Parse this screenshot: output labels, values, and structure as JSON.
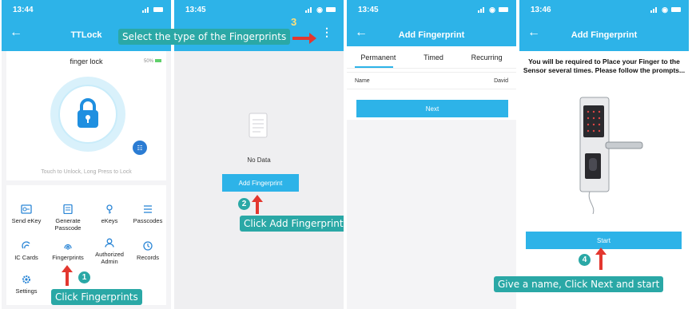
{
  "colors": {
    "accent": "#2db3e8",
    "callout": "#2aa8a6",
    "arrow": "#e3372f"
  },
  "screen1": {
    "time": "13:44",
    "title": "TTLock",
    "lock_name": "finger lock",
    "battery": "50%",
    "unlock_hint": "Touch to Unlock, Long Press to Lock",
    "menu": [
      {
        "label": "Send eKey",
        "icon": "send-ekey-icon"
      },
      {
        "label": "Generate Passcode",
        "icon": "passcode-icon"
      },
      {
        "label": "eKeys",
        "icon": "ekeys-icon"
      },
      {
        "label": "Passcodes",
        "icon": "passcodes-icon"
      },
      {
        "label": "IC Cards",
        "icon": "ic-card-icon"
      },
      {
        "label": "Fingerprints",
        "icon": "fingerprint-icon"
      },
      {
        "label": "Authorized Admin",
        "icon": "admin-icon"
      },
      {
        "label": "Records",
        "icon": "records-icon"
      },
      {
        "label": "Settings",
        "icon": "settings-icon"
      }
    ],
    "step_badge": "1",
    "callout": "Click Fingerprints"
  },
  "screen2": {
    "time": "13:45",
    "empty_text": "No Data",
    "add_button": "Add Fingerprint",
    "step_badge": "2",
    "callout": "Click Add Fingerprints",
    "step3_number": "3",
    "step3_callout": "Select the type of the Fingerprints"
  },
  "screen3": {
    "time": "13:45",
    "title": "Add Fingerprint",
    "tabs": [
      "Permanent",
      "Timed",
      "Recurring"
    ],
    "name_label": "Name",
    "name_value": "David",
    "next_button": "Next"
  },
  "screen4": {
    "time": "13:46",
    "title": "Add Fingerprint",
    "instructions": "You will be required to Place your Finger to the Sensor several times. Please follow the prompts...",
    "start_button": "Start",
    "step_badge": "4",
    "callout": "Give a name, Click Next and start"
  }
}
